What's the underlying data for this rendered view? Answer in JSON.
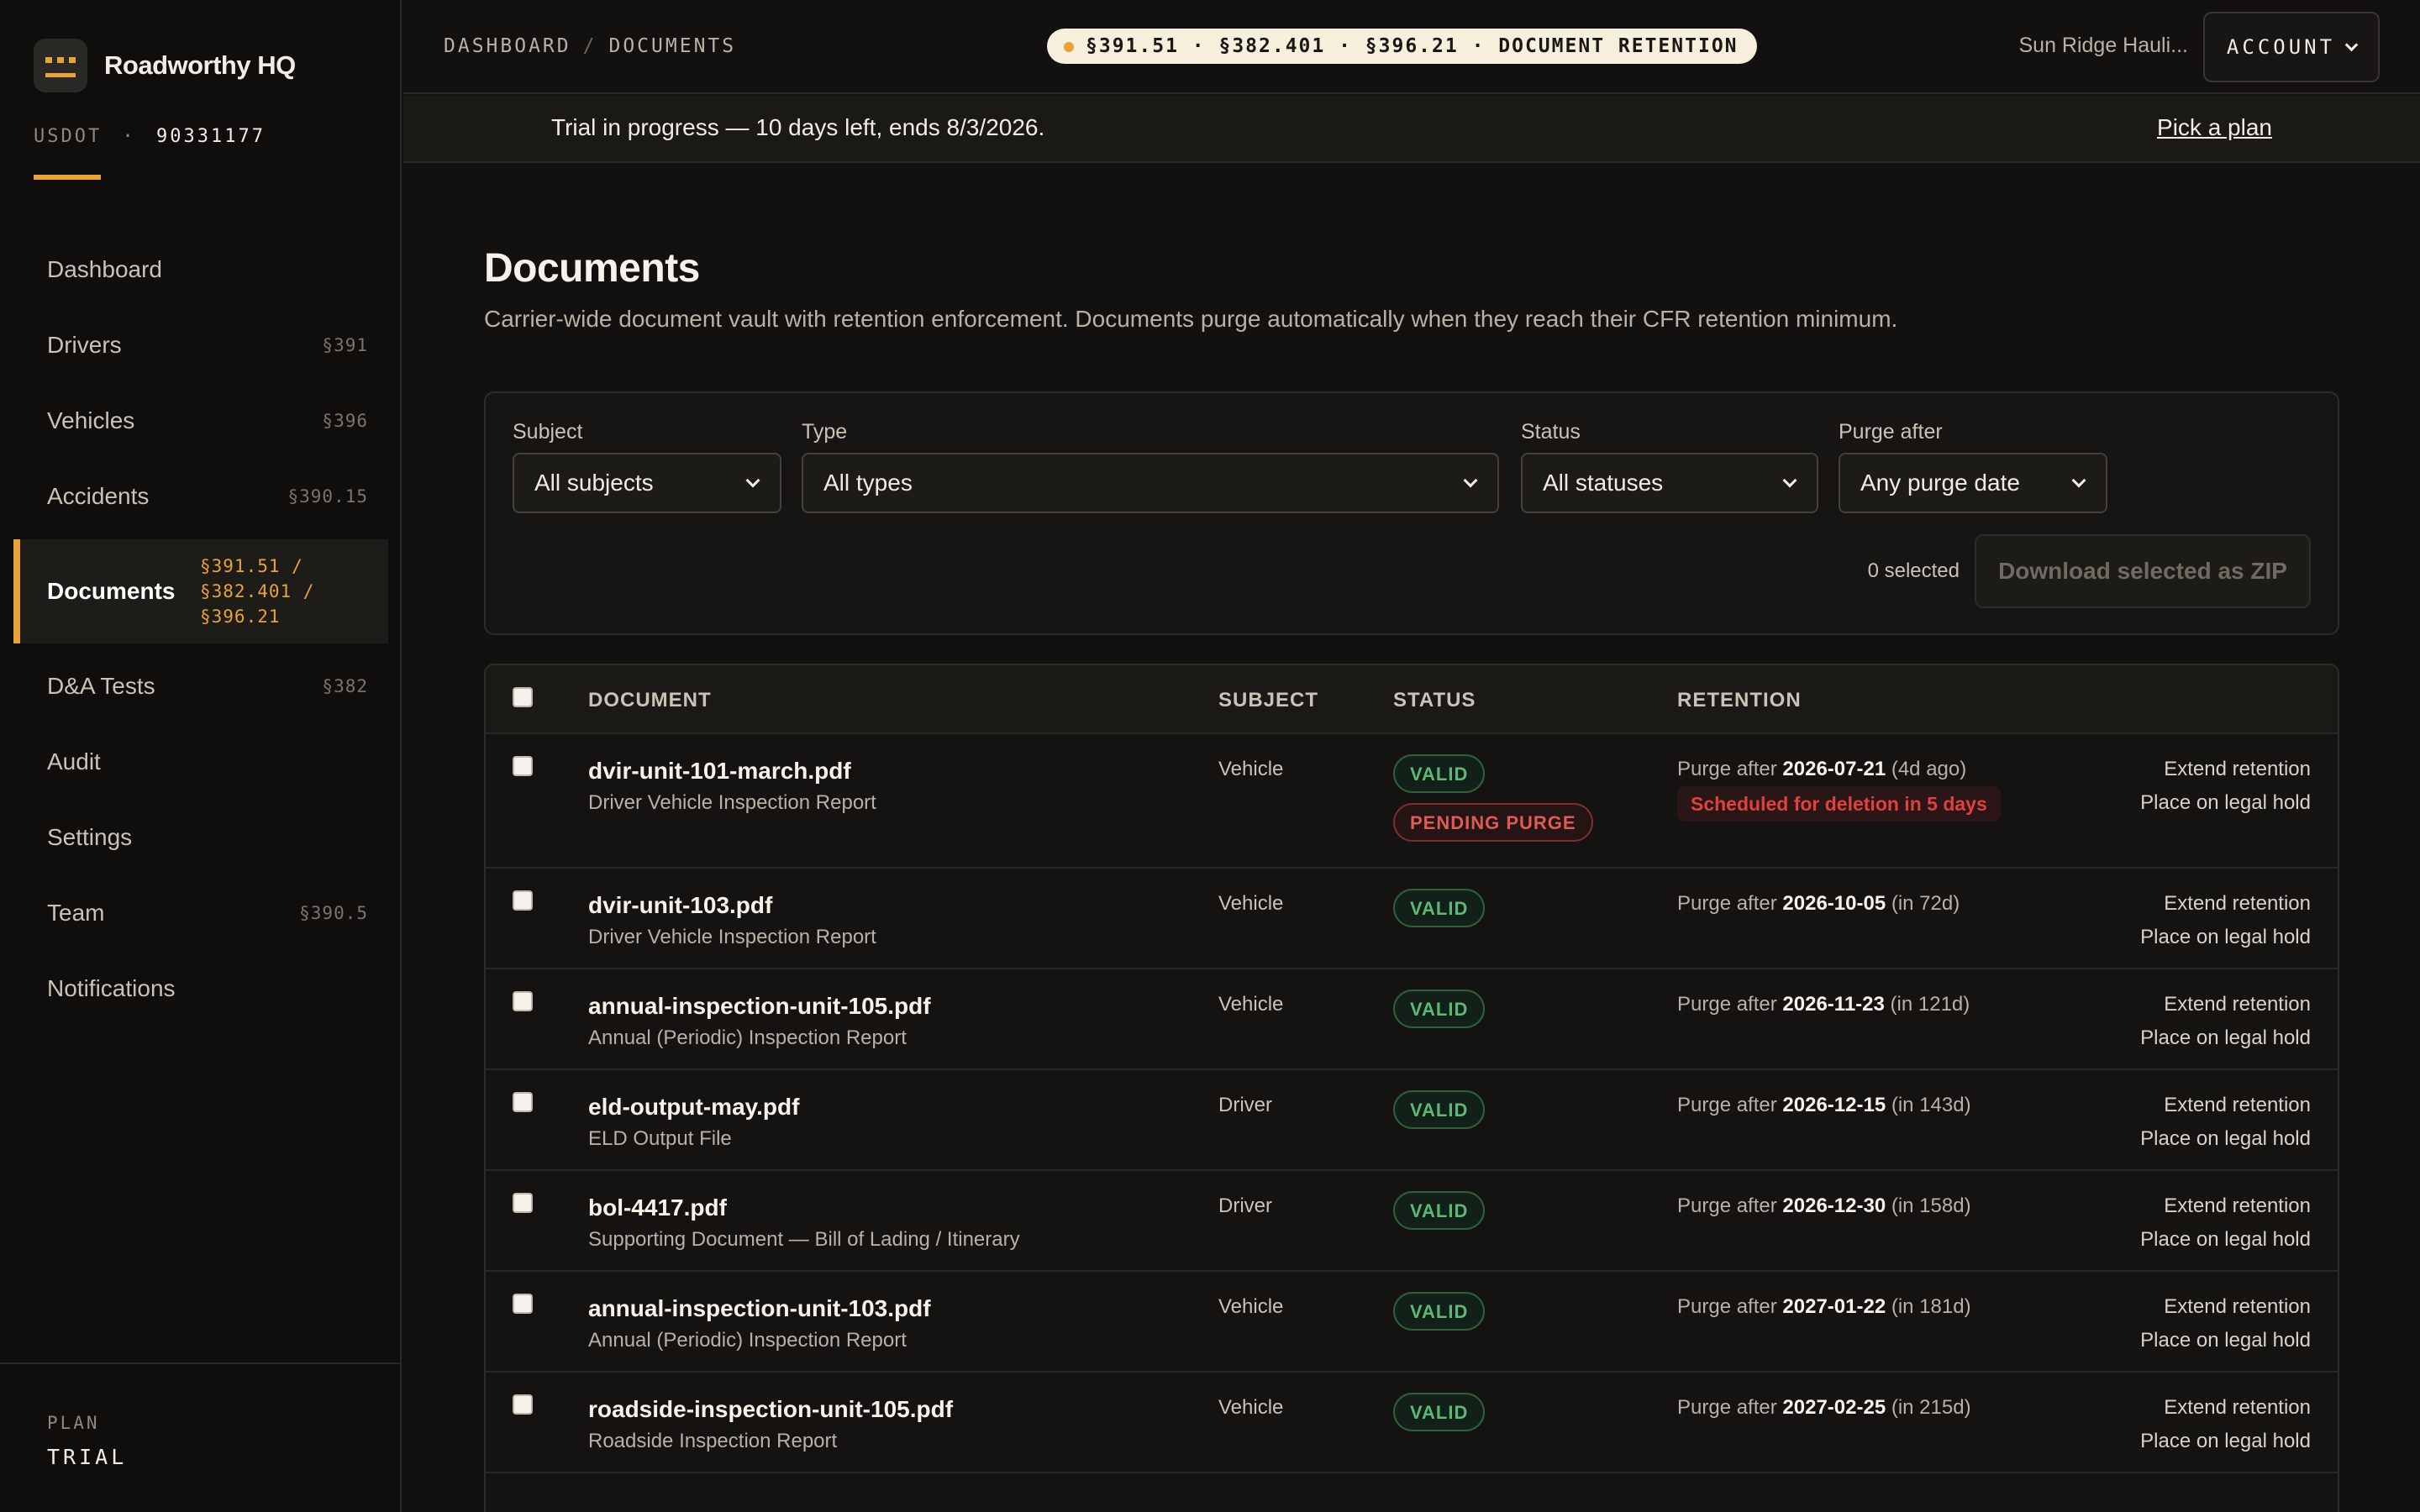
{
  "brand": {
    "name": "Roadworthy HQ",
    "usdot_label": "USDOT",
    "usdot_sep": "·",
    "usdot_number": "90331177"
  },
  "nav": [
    {
      "label": "Dashboard",
      "section": ""
    },
    {
      "label": "Drivers",
      "section": "§391"
    },
    {
      "label": "Vehicles",
      "section": "§396"
    },
    {
      "label": "Accidents",
      "section": "§390.15"
    },
    {
      "label": "Documents",
      "section": "§391.51 / §382.401 / §396.21",
      "active": true
    },
    {
      "label": "D&A Tests",
      "section": "§382"
    },
    {
      "label": "Audit",
      "section": ""
    },
    {
      "label": "Settings",
      "section": ""
    },
    {
      "label": "Team",
      "section": "§390.5"
    },
    {
      "label": "Notifications",
      "section": ""
    }
  ],
  "plan": {
    "label": "PLAN",
    "value": "TRIAL"
  },
  "topbar": {
    "breadcrumb": [
      "DASHBOARD",
      "DOCUMENTS"
    ],
    "breadcrumb_sep": "/",
    "pill": "§391.51 · §382.401 · §396.21 · DOCUMENT RETENTION",
    "org": "Sun Ridge Hauli...",
    "account": "ACCOUNT"
  },
  "trial": {
    "text": "Trial in progress — 10 days left, ends 8/3/2026.",
    "link": "Pick a plan"
  },
  "page": {
    "title": "Documents",
    "subtitle": "Carrier-wide document vault with retention enforcement. Documents purge automatically when they reach their CFR retention minimum."
  },
  "filters": {
    "subject": {
      "label": "Subject",
      "value": "All subjects"
    },
    "type": {
      "label": "Type",
      "value": "All types"
    },
    "status": {
      "label": "Status",
      "value": "All statuses"
    },
    "purge": {
      "label": "Purge after",
      "value": "Any purge date"
    },
    "selected": "0 selected",
    "zip": "Download selected as ZIP"
  },
  "table": {
    "headers": {
      "document": "DOCUMENT",
      "subject": "SUBJECT",
      "status": "STATUS",
      "retention": "RETENTION"
    },
    "purge_prefix": "Purge after",
    "actions": {
      "extend": "Extend retention",
      "hold": "Place on legal hold"
    },
    "rows": [
      {
        "name": "dvir-unit-101-march.pdf",
        "type": "Driver Vehicle Inspection Report",
        "subject": "Vehicle",
        "status": "VALID",
        "status2": "PENDING PURGE",
        "date": "2026-07-21",
        "rel": "(4d ago)",
        "warning": "Scheduled for deletion in 5 days"
      },
      {
        "name": "dvir-unit-103.pdf",
        "type": "Driver Vehicle Inspection Report",
        "subject": "Vehicle",
        "status": "VALID",
        "date": "2026-10-05",
        "rel": "(in 72d)"
      },
      {
        "name": "annual-inspection-unit-105.pdf",
        "type": "Annual (Periodic) Inspection Report",
        "subject": "Vehicle",
        "status": "VALID",
        "date": "2026-11-23",
        "rel": "(in 121d)"
      },
      {
        "name": "eld-output-may.pdf",
        "type": "ELD Output File",
        "subject": "Driver",
        "status": "VALID",
        "date": "2026-12-15",
        "rel": "(in 143d)"
      },
      {
        "name": "bol-4417.pdf",
        "type": "Supporting Document — Bill of Lading / Itinerary",
        "subject": "Driver",
        "status": "VALID",
        "date": "2026-12-30",
        "rel": "(in 158d)"
      },
      {
        "name": "annual-inspection-unit-103.pdf",
        "type": "Annual (Periodic) Inspection Report",
        "subject": "Vehicle",
        "status": "VALID",
        "date": "2027-01-22",
        "rel": "(in 181d)"
      },
      {
        "name": "roadside-inspection-unit-105.pdf",
        "type": "Roadside Inspection Report",
        "subject": "Vehicle",
        "status": "VALID",
        "date": "2027-02-25",
        "rel": "(in 215d)"
      }
    ]
  },
  "colors": {
    "accent": "#e8a23a",
    "valid": "#5cb873",
    "danger": "#e0403e",
    "background": "#121110"
  },
  "icons": {
    "logo": "truck-logo-icon",
    "dropdown": "chevron-down-icon"
  }
}
